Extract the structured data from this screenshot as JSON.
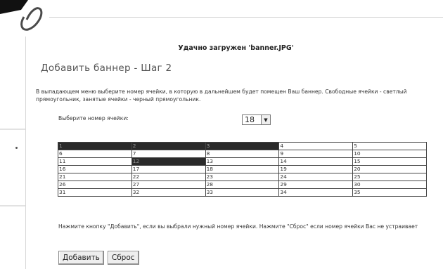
{
  "status_message": "Удачно загружен 'banner.JPG'",
  "page_title": "Добавить баннер - Шаг 2",
  "instructions": "В выпадающем меню выберите номер ячейки, в которую в дальнейшем будет помещен Ваш баннер. Свободные ячейки - светлый прямоугольник, занятые ячейки - черный прямоугольник.",
  "cell_select": {
    "label": "Выберите номер ячейки:",
    "selected_value": "18"
  },
  "grid": {
    "rows": [
      [
        "1",
        "2",
        "3",
        "4",
        "5"
      ],
      [
        "6",
        "7",
        "8",
        "9",
        "10"
      ],
      [
        "11",
        "12",
        "13",
        "14",
        "15"
      ],
      [
        "16",
        "17",
        "18",
        "19",
        "20"
      ],
      [
        "21",
        "22",
        "23",
        "24",
        "25"
      ],
      [
        "26",
        "27",
        "28",
        "29",
        "30"
      ],
      [
        "31",
        "32",
        "33",
        "34",
        "35"
      ]
    ],
    "taken_cells": [
      "1",
      "2",
      "3",
      "12"
    ]
  },
  "hint": "Нажмите кнопку \"Добавить\", если вы выбрали нужный номер ячейки. Нажмите \"Сброс\" если номер ячейки Вас не устраивает",
  "buttons": {
    "add_label": "Добавить",
    "reset_label": "Сброс"
  },
  "colors": {
    "taken_cell": "#2a2a2a",
    "free_cell": "#ffffff"
  }
}
